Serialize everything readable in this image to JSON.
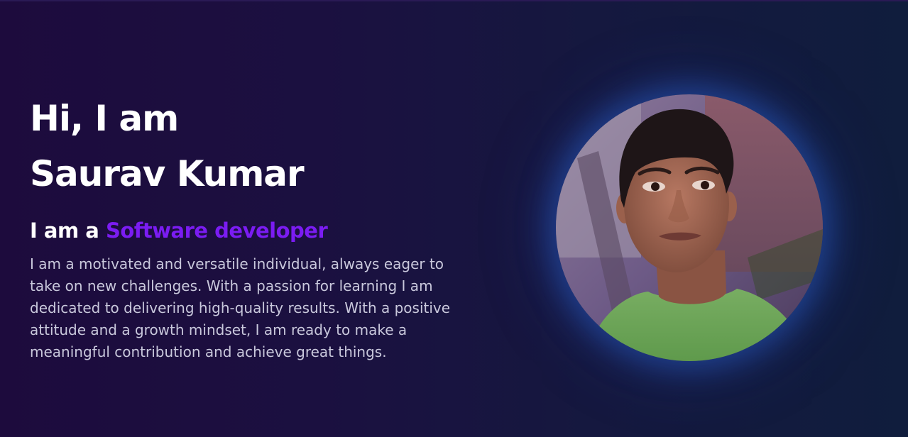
{
  "hero": {
    "greeting_line1": "Hi, I am",
    "greeting_line2": "Saurav Kumar",
    "role_prefix": "I am a",
    "role_highlight": "Software developer",
    "bio": "I am a motivated and versatile individual, always eager to take on new challenges. With a passion for learning I am dedicated to delivering high-quality results. With a positive attitude and a growth mindset, I am ready to make a meaningful contribution and achieve great things."
  },
  "colors": {
    "accent": "#7b1cf2",
    "heading": "#ffffff",
    "body_text": "#c9c8dc",
    "glow": "#2d5bbf"
  },
  "avatar": {
    "icon": "profile-photo"
  }
}
